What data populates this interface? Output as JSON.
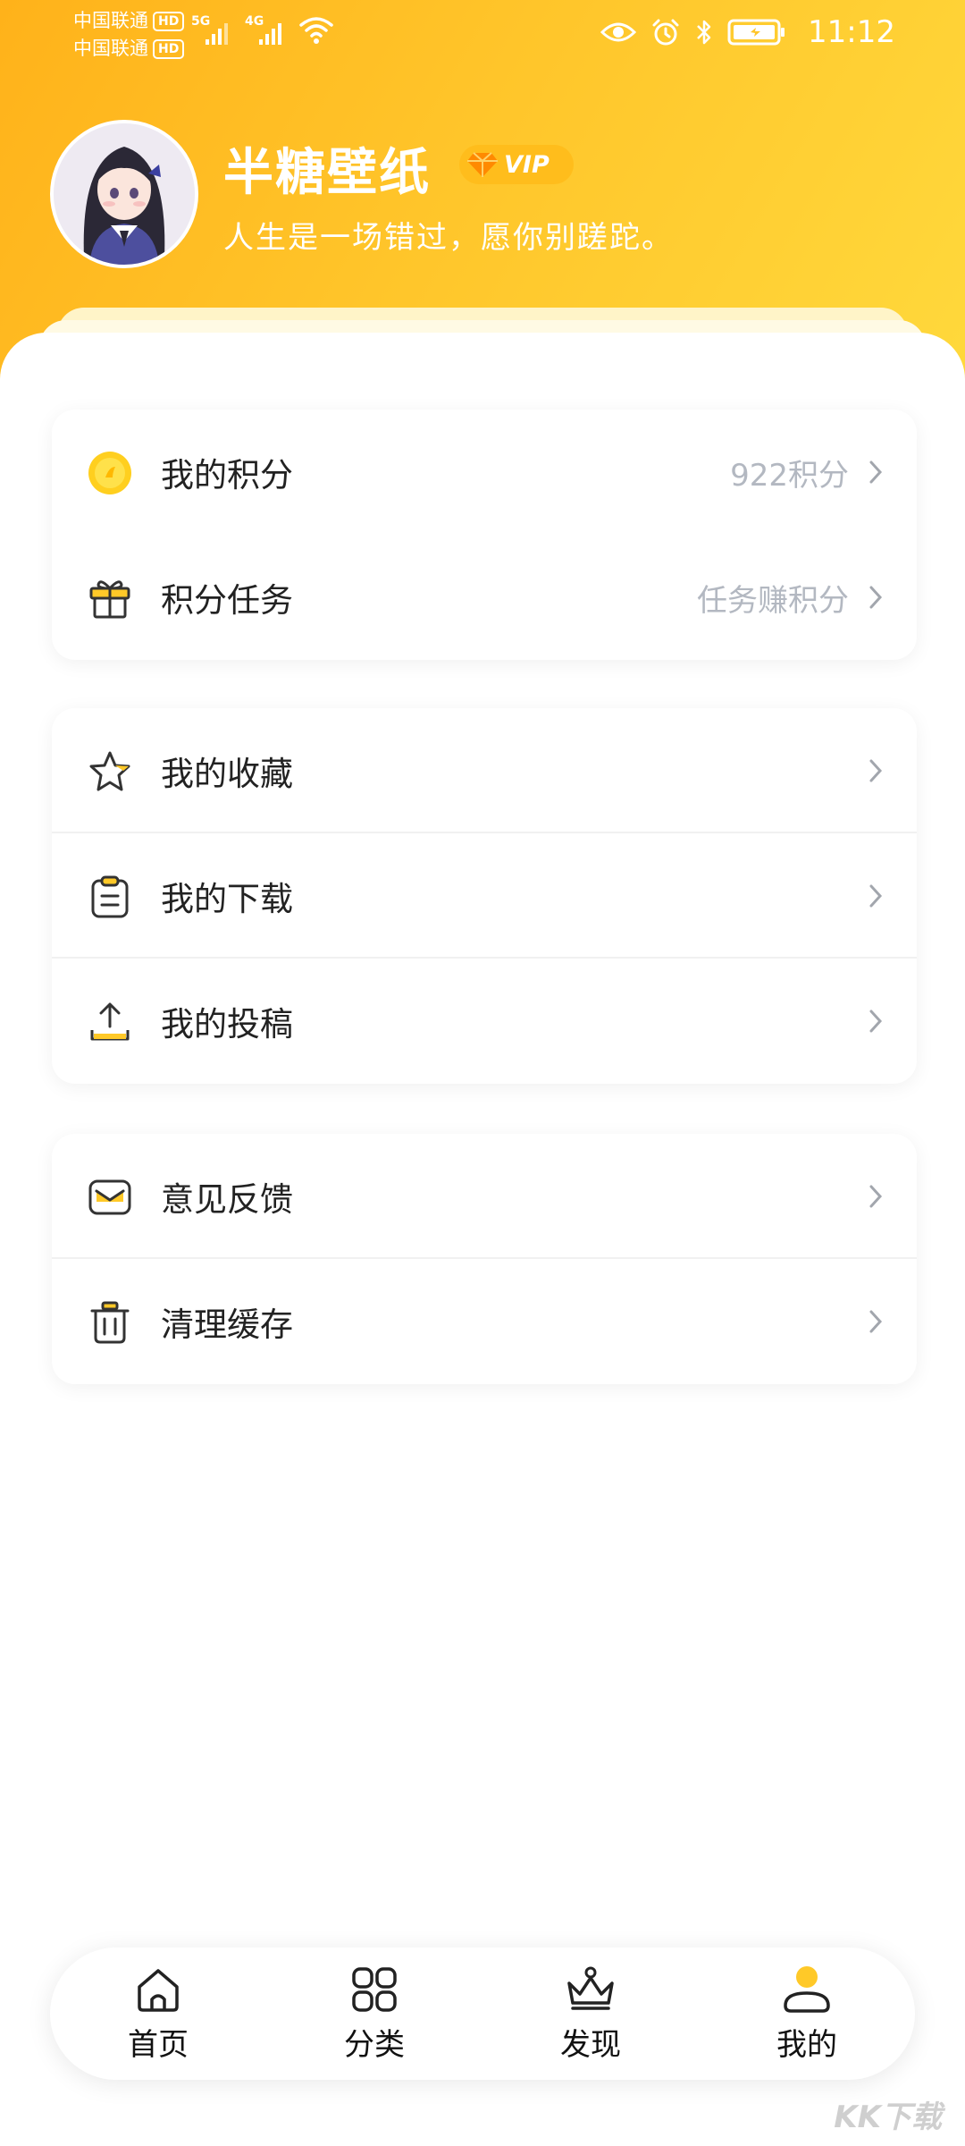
{
  "status_bar": {
    "carrier_1": "中国联通",
    "carrier_2": "中国联通",
    "hd_badge": "HD",
    "network_1": "5G",
    "network_2": "4G",
    "time": "11:12",
    "icons": [
      "eye-icon",
      "alarm-icon",
      "bluetooth-icon",
      "battery-icon",
      "wifi-icon",
      "signal-icon"
    ]
  },
  "profile": {
    "name": "半糖壁纸",
    "vip_label": "VIP",
    "motto": "人生是一场错过，愿你别蹉跎。"
  },
  "cards": {
    "points": {
      "items": [
        {
          "label": "我的积分",
          "value": "922积分",
          "icon": "coin-icon"
        },
        {
          "label": "积分任务",
          "value": "任务赚积分",
          "icon": "gift-icon"
        }
      ]
    },
    "content": {
      "items": [
        {
          "label": "我的收藏",
          "icon": "star-icon"
        },
        {
          "label": "我的下载",
          "icon": "clipboard-icon"
        },
        {
          "label": "我的投稿",
          "icon": "upload-icon"
        }
      ]
    },
    "settings": {
      "items": [
        {
          "label": "意见反馈",
          "icon": "mail-icon"
        },
        {
          "label": "清理缓存",
          "icon": "trash-icon"
        }
      ]
    }
  },
  "bottom_nav": {
    "items": [
      {
        "label": "首页",
        "icon": "home-icon"
      },
      {
        "label": "分类",
        "icon": "grid-icon"
      },
      {
        "label": "发现",
        "icon": "crown-icon"
      },
      {
        "label": "我的",
        "icon": "person-icon",
        "active": true
      }
    ]
  },
  "watermark": "KK下载",
  "colors": {
    "header_gradient_start": "#ffb21a",
    "header_gradient_end": "#ffd93c",
    "accent": "#ffc928",
    "muted_text": "#b3b8c1"
  }
}
